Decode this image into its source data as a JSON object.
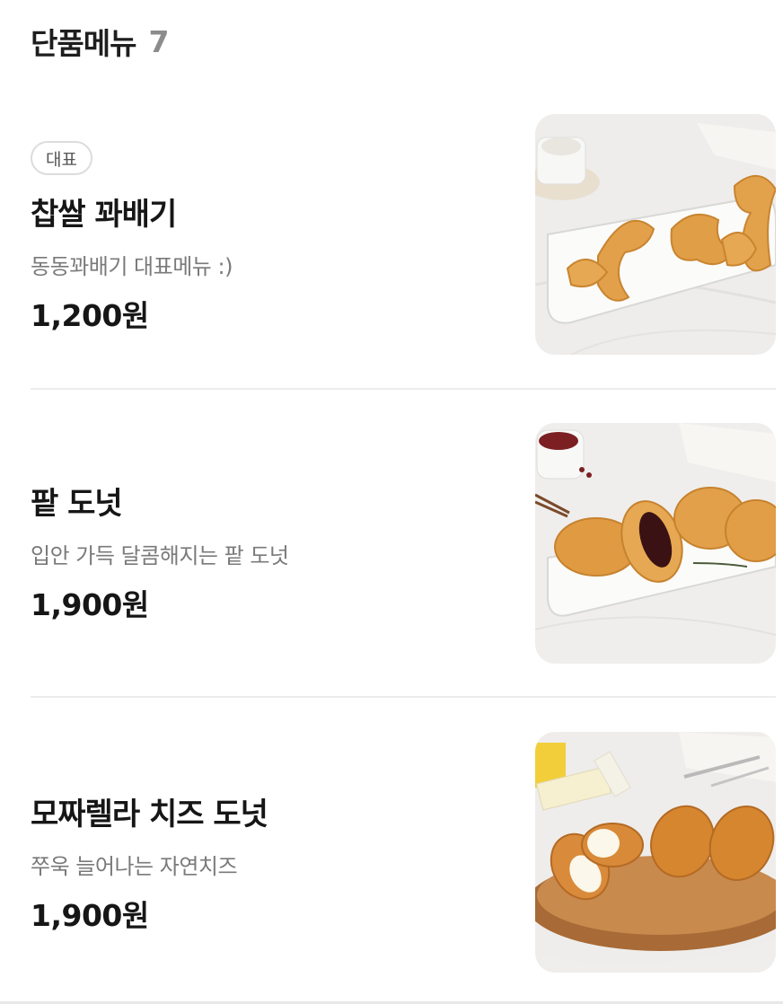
{
  "section": {
    "title": "단품메뉴",
    "count": "7"
  },
  "items": [
    {
      "badge": "대표",
      "name": "찹쌀 꽈배기",
      "description": "동동꽈배기 대표메뉴 :)",
      "price": "1,200원",
      "image": "twisted-donut-photo"
    },
    {
      "name": "팥 도넛",
      "description": "입안 가득 달콤해지는 팥 도넛",
      "price": "1,900원",
      "image": "red-bean-donut-photo"
    },
    {
      "name": "모짜렐라 치즈 도넛",
      "description": "쭈욱 늘어나는 자연치즈",
      "price": "1,900원",
      "image": "mozzarella-cheese-donut-photo"
    }
  ],
  "colors": {
    "text": "#161616",
    "muted": "#7a7a7a",
    "divider": "#ececec",
    "donut": "#e0a24a"
  }
}
